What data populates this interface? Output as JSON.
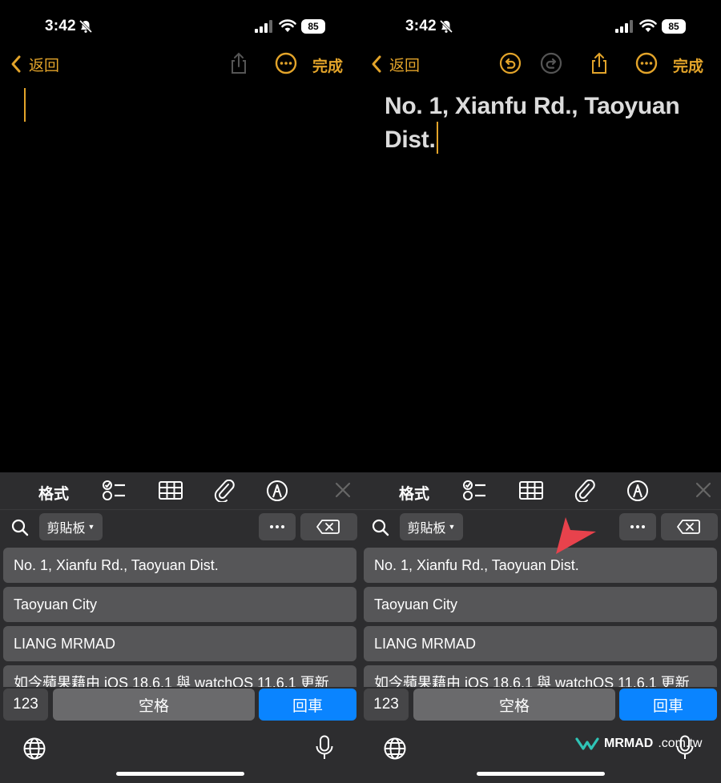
{
  "colors": {
    "accent": "#e3a42a",
    "return_key": "#0a84ff",
    "pointer_arrow": "#e8424c"
  },
  "left": {
    "status": {
      "time": "3:42",
      "battery": "85"
    },
    "nav": {
      "back_label": "返回",
      "done_label": "完成"
    },
    "note_text": "",
    "keyboard": {
      "format_label": "格式",
      "clipboard_label": "剪貼板",
      "clipboard_items": [
        "No. 1, Xianfu Rd., Taoyuan Dist.",
        "Taoyuan City",
        "LIANG MRMAD",
        "如今蘋果藉由 iOS 18.6.1 與 watchOS 11.6.1 更新"
      ],
      "key_123": "123",
      "key_space": "空格",
      "key_return": "回車"
    }
  },
  "right": {
    "status": {
      "time": "3:42",
      "battery": "85"
    },
    "nav": {
      "back_label": "返回",
      "done_label": "完成"
    },
    "note_text": "No. 1, Xianfu Rd., Taoyuan Dist.",
    "keyboard": {
      "format_label": "格式",
      "clipboard_label": "剪貼板",
      "clipboard_items": [
        "No. 1, Xianfu Rd., Taoyuan Dist.",
        "Taoyuan City",
        "LIANG MRMAD",
        "如今蘋果藉由 iOS 18.6.1 與 watchOS 11.6.1 更新"
      ],
      "key_123": "123",
      "key_space": "空格",
      "key_return": "回車"
    }
  },
  "watermark": {
    "brand": "MRMAD",
    "tld": ".com.tw"
  }
}
